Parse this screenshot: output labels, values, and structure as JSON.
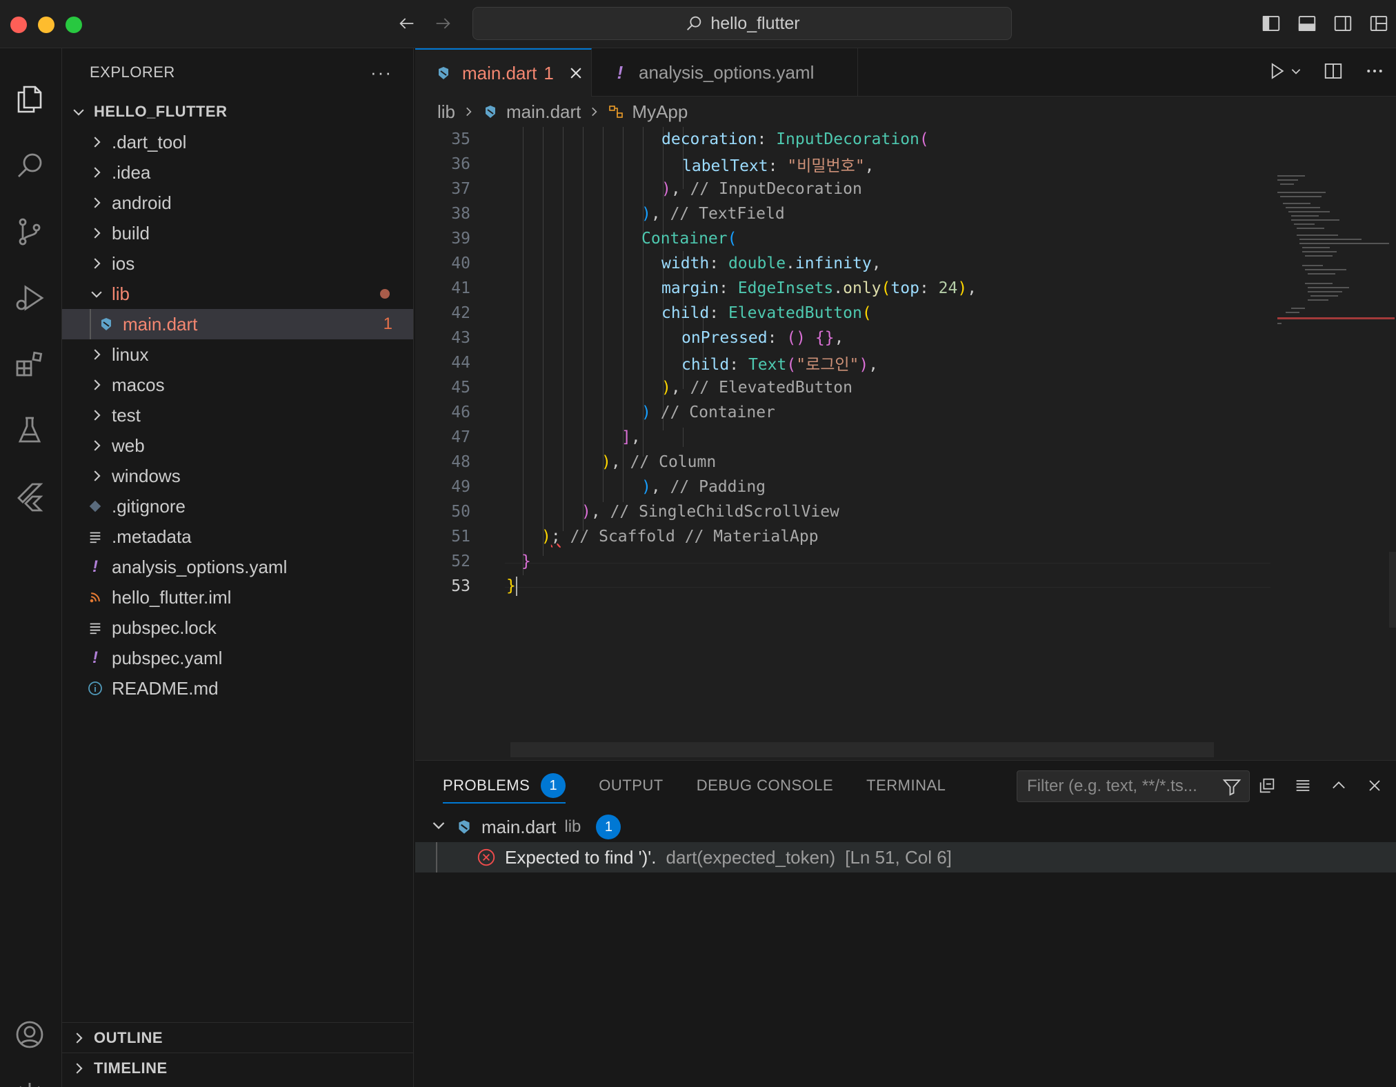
{
  "title": "hello_flutter",
  "sidebar": {
    "header": "EXPLORER",
    "more": "···",
    "root": "HELLO_FLUTTER",
    "items": [
      {
        "label": ".dart_tool"
      },
      {
        "label": ".idea"
      },
      {
        "label": "android"
      },
      {
        "label": "build"
      },
      {
        "label": "ios"
      },
      {
        "label": "lib"
      },
      {
        "label": "main.dart",
        "badge": "1"
      },
      {
        "label": "linux"
      },
      {
        "label": "macos"
      },
      {
        "label": "test"
      },
      {
        "label": "web"
      },
      {
        "label": "windows"
      },
      {
        "label": ".gitignore"
      },
      {
        "label": ".metadata"
      },
      {
        "label": "analysis_options.yaml"
      },
      {
        "label": "hello_flutter.iml"
      },
      {
        "label": "pubspec.lock"
      },
      {
        "label": "pubspec.yaml"
      },
      {
        "label": "README.md"
      }
    ],
    "outline": "OUTLINE",
    "timeline": "TIMELINE"
  },
  "tabs": [
    {
      "label": "main.dart",
      "badge": "1"
    },
    {
      "label": "analysis_options.yaml"
    }
  ],
  "breadcrumbs": {
    "a": "lib",
    "b": "main.dart",
    "c": "MyApp"
  },
  "code": {
    "l35": {
      "n": "35",
      "a": "decoration",
      "b": ": ",
      "c": "InputDecoration",
      "d": "("
    },
    "l36": {
      "n": "36",
      "a": "labelText",
      "b": ": ",
      "c": "\"비밀번호\"",
      "d": ","
    },
    "l37": {
      "n": "37",
      "a": ")",
      "b": ", ",
      "c": "// InputDecoration"
    },
    "l38": {
      "n": "38",
      "a": ")",
      "b": ", ",
      "c": "// TextField"
    },
    "l39": {
      "n": "39",
      "a": "Container",
      "b": "("
    },
    "l40": {
      "n": "40",
      "a": "width",
      "b": ": ",
      "c": "double",
      "d": ".",
      "e": "infinity",
      "f": ","
    },
    "l41": {
      "n": "41",
      "a": "margin",
      "b": ": ",
      "c": "EdgeInsets",
      "d": ".",
      "e": "only",
      "f": "(",
      "g": "top",
      "h": ": ",
      "i": "24",
      "j": ")",
      "k": ","
    },
    "l42": {
      "n": "42",
      "a": "child",
      "b": ": ",
      "c": "ElevatedButton",
      "d": "("
    },
    "l43": {
      "n": "43",
      "a": "onPressed",
      "b": ": ",
      "c": "()",
      "d": " ",
      "e": "{}",
      "f": ","
    },
    "l44": {
      "n": "44",
      "a": "child",
      "b": ": ",
      "c": "Text",
      "d": "(",
      "e": "\"로그인\"",
      "f": ")",
      "g": ","
    },
    "l45": {
      "n": "45",
      "a": ")",
      "b": ", ",
      "c": "// ElevatedButton"
    },
    "l46": {
      "n": "46",
      "a": ")",
      "b": " ",
      "c": "// Container"
    },
    "l47": {
      "n": "47",
      "a": "]",
      "b": ","
    },
    "l48": {
      "n": "48",
      "a": ")",
      "b": ", ",
      "c": "// Column"
    },
    "l49": {
      "n": "49",
      "a": ")",
      "b": ", ",
      "c": "// Padding"
    },
    "l50": {
      "n": "50",
      "a": ")",
      "b": ", ",
      "c": "// SingleChildScrollView"
    },
    "l51": {
      "n": "51",
      "a": ")",
      "b": ";",
      "c": " // Scaffold // MaterialApp"
    },
    "l52": {
      "n": "52",
      "a": "}"
    },
    "l53": {
      "n": "53",
      "a": "}"
    }
  },
  "panel": {
    "tabs": {
      "problems": "PROBLEMS",
      "output": "OUTPUT",
      "debug": "DEBUG CONSOLE",
      "terminal": "TERMINAL"
    },
    "problems_count": "1",
    "filter_placeholder": "Filter (e.g. text, **/*.ts...",
    "file": {
      "name": "main.dart",
      "folder": "lib",
      "count": "1"
    },
    "problem": {
      "message": "Expected to find ')'.",
      "source": "dart(expected_token)",
      "location": "[Ln 51, Col 6]"
    }
  },
  "colors": {
    "accent": "#0078d4",
    "error": "#f14c4c",
    "modified": "#f48771"
  }
}
